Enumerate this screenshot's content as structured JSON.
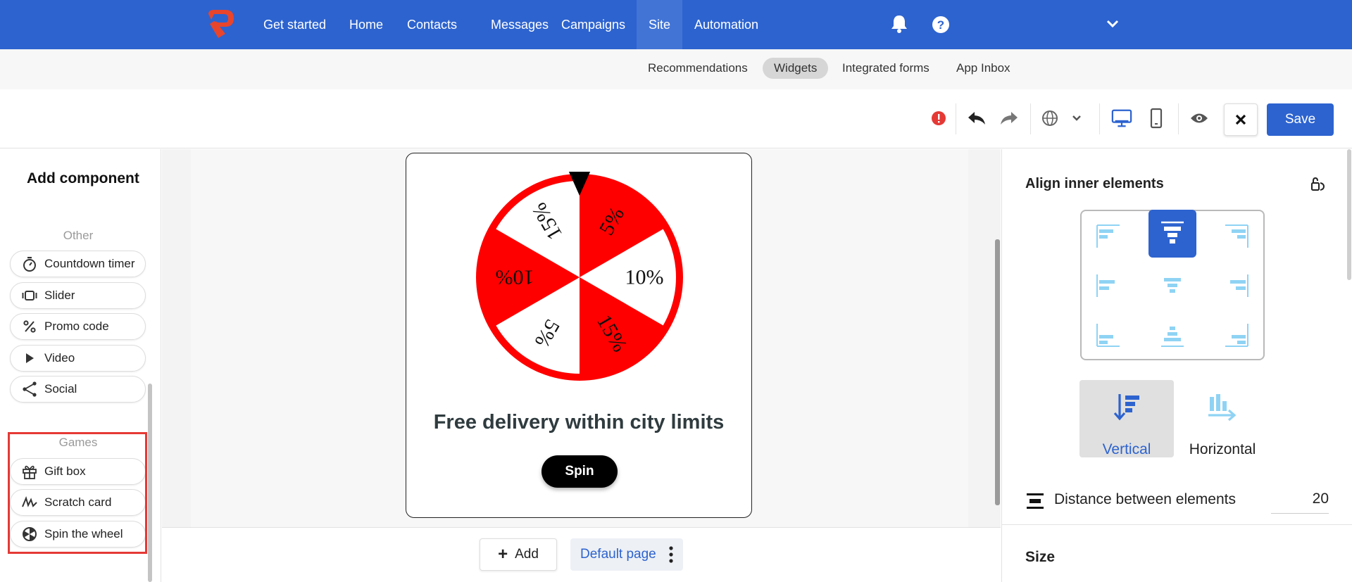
{
  "nav": {
    "items": [
      {
        "label": "Get started"
      },
      {
        "label": "Home"
      },
      {
        "label": "Contacts"
      },
      {
        "label": "Messages"
      },
      {
        "label": "Campaigns"
      },
      {
        "label": "Site"
      },
      {
        "label": "Automation"
      }
    ],
    "active": "Site"
  },
  "subnav": {
    "items": [
      {
        "label": "Recommendations"
      },
      {
        "label": "Widgets"
      },
      {
        "label": "Integrated forms"
      },
      {
        "label": "App Inbox"
      }
    ],
    "active": "Widgets"
  },
  "toolbar": {
    "save_label": "Save",
    "icons": [
      "error-icon",
      "undo-icon",
      "redo-icon",
      "globe-icon",
      "chevron-down-icon",
      "desktop-icon",
      "mobile-icon",
      "eye-icon",
      "close-icon"
    ]
  },
  "left_panel": {
    "title": "Add component",
    "groups": [
      {
        "label": "Other",
        "items": [
          {
            "label": "Countdown timer",
            "icon": "timer-icon"
          },
          {
            "label": "Slider",
            "icon": "slider-icon"
          },
          {
            "label": "Promo code",
            "icon": "percent-icon"
          },
          {
            "label": "Video",
            "icon": "play-icon"
          },
          {
            "label": "Social",
            "icon": "share-icon"
          }
        ]
      },
      {
        "label": "Games",
        "items": [
          {
            "label": "Gift box",
            "icon": "gift-icon"
          },
          {
            "label": "Scratch card",
            "icon": "scratch-icon"
          },
          {
            "label": "Spin the wheel",
            "icon": "wheel-icon"
          }
        ]
      }
    ]
  },
  "widget": {
    "wheel_segments": [
      "5%",
      "10%",
      "15%",
      "5%",
      "10%",
      "15%"
    ],
    "title": "Free delivery within city limits",
    "spin_label": "Spin",
    "colors": {
      "red": "#ff0000",
      "white": "#ffffff"
    }
  },
  "bottom_bar": {
    "add_label": "Add",
    "page_label": "Default page"
  },
  "right_panel": {
    "align_title": "Align inner elements",
    "direction_options": [
      {
        "label": "Vertical",
        "selected": true
      },
      {
        "label": "Horizontal",
        "selected": false
      }
    ],
    "distance_label": "Distance between elements",
    "distance_value": "20",
    "size_title": "Size"
  },
  "colors": {
    "brand": "#2d63cf",
    "accent_light": "#8fd3f4",
    "highlight_box": "#e53935"
  }
}
